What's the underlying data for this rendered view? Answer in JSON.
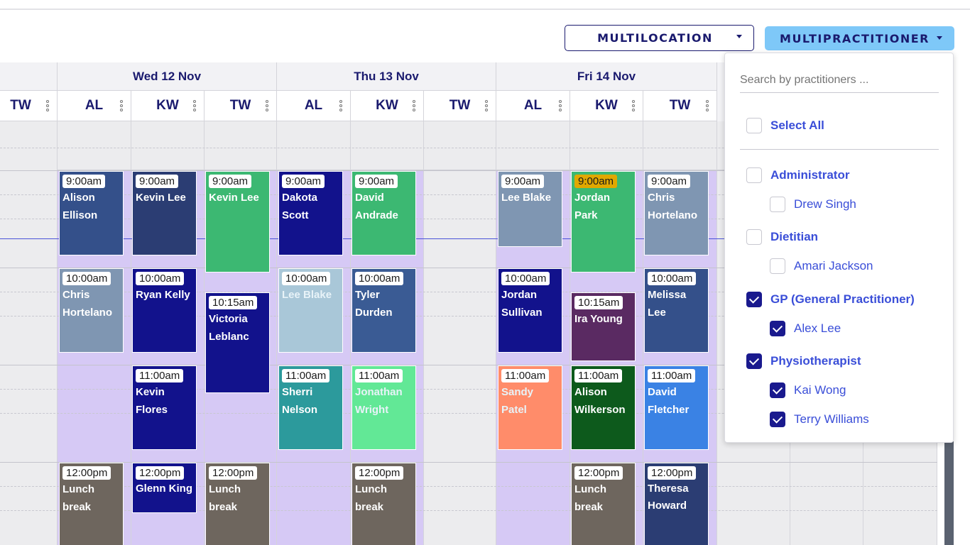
{
  "toolbar": {
    "multilocation_label": "MULTILOCATION",
    "multipractitioner_label": "MULTIPRACTITIONER"
  },
  "days": [
    {
      "label": "Wed 12 Nov",
      "columns": [
        "AL",
        "KW",
        "TW"
      ]
    },
    {
      "label": "Thu 13 Nov",
      "columns": [
        "AL",
        "KW",
        "TW"
      ]
    },
    {
      "label": "Fri 14 Nov",
      "columns": [
        "AL",
        "KW",
        "TW"
      ]
    }
  ],
  "partial_column": "TW",
  "appointments": {
    "wed_al": [
      {
        "time": "9:00am",
        "name": "Alison Ellison"
      },
      {
        "time": "10:00am",
        "name": "Chris Hortelano"
      },
      {
        "time": "12:00pm",
        "name": "Lunch break"
      }
    ],
    "wed_kw": [
      {
        "time": "9:00am",
        "name": "Kevin Lee"
      },
      {
        "time": "10:00am",
        "name": "Ryan Kelly"
      },
      {
        "time": "11:00am",
        "name": "Kevin Flores"
      },
      {
        "time": "12:00pm",
        "name": "Glenn King"
      }
    ],
    "wed_tw": [
      {
        "time": "9:00am",
        "name": "Kevin Lee"
      },
      {
        "time": "10:15am",
        "name": "Victoria Leblanc"
      },
      {
        "time": "12:00pm",
        "name": "Lunch break"
      }
    ],
    "thu_al": [
      {
        "time": "9:00am",
        "name": "Dakota Scott"
      },
      {
        "time": "10:00am",
        "name": "Lee Blake"
      },
      {
        "time": "11:00am",
        "name": "Sherri Nelson"
      }
    ],
    "thu_kw": [
      {
        "time": "9:00am",
        "name": "David Andrade"
      },
      {
        "time": "10:00am",
        "name": "Tyler Durden"
      },
      {
        "time": "11:00am",
        "name": "Jonathan Wright"
      },
      {
        "time": "12:00pm",
        "name": "Lunch break"
      }
    ],
    "fri_al": [
      {
        "time": "9:00am",
        "name": "Lee Blake"
      },
      {
        "time": "10:00am",
        "name": "Jordan Sullivan"
      },
      {
        "time": "11:00am",
        "name": "Sandy Patel"
      }
    ],
    "fri_kw": [
      {
        "time": "9:00am",
        "name": "Jordan Park"
      },
      {
        "time": "10:15am",
        "name": "Ira Young"
      },
      {
        "time": "11:00am",
        "name": "Alison Wilkerson"
      },
      {
        "time": "12:00pm",
        "name": "Lunch break"
      }
    ],
    "fri_tw": [
      {
        "time": "9:00am",
        "name": "Chris Hortelano"
      },
      {
        "time": "10:00am",
        "name": "Melissa Lee"
      },
      {
        "time": "11:00am",
        "name": "David Fletcher"
      },
      {
        "time": "12:00pm",
        "name": "Theresa Howard"
      }
    ]
  },
  "dropdown": {
    "search_placeholder": "Search by practitioners ...",
    "select_all": {
      "label": "Select All",
      "checked": false
    },
    "groups": [
      {
        "label": "Administrator",
        "checked": false,
        "items": [
          {
            "label": "Drew Singh",
            "checked": false
          }
        ]
      },
      {
        "label": "Dietitian",
        "checked": false,
        "items": [
          {
            "label": "Amari Jackson",
            "checked": false
          }
        ]
      },
      {
        "label": "GP (General Practitioner)",
        "checked": true,
        "items": [
          {
            "label": "Alex Lee",
            "checked": true
          }
        ]
      },
      {
        "label": "Physiotherapist",
        "checked": true,
        "items": [
          {
            "label": "Kai Wong",
            "checked": true
          },
          {
            "label": "Terry Williams",
            "checked": true
          }
        ]
      }
    ]
  },
  "colors": {
    "brand_navy": "#1a1a6e",
    "accent_blue": "#7ec8f8",
    "link_blue": "#3a4ed8",
    "open_hours": "#d6c9f5"
  }
}
